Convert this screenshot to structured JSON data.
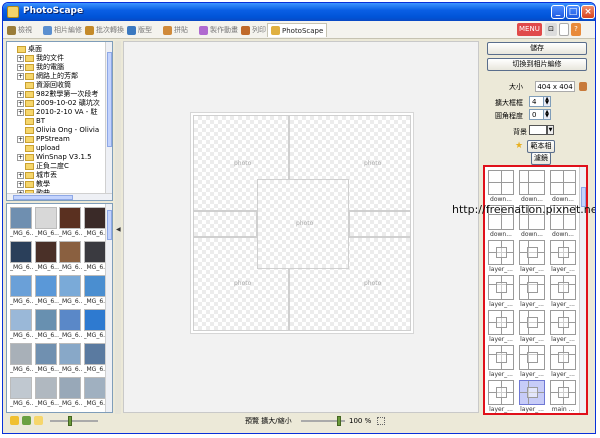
{
  "window": {
    "title": "PhotoScape"
  },
  "tabs": [
    {
      "label": "檢視",
      "icon": "viewer-icon",
      "color": "#9a7d3a"
    },
    {
      "label": "相片編修",
      "icon": "editor-icon",
      "color": "#5a8fd0"
    },
    {
      "label": "批次轉換",
      "icon": "batch-icon",
      "color": "#c48a2a"
    },
    {
      "label": "版型",
      "icon": "page-icon",
      "color": "#3a78c0"
    },
    {
      "label": "拼貼",
      "icon": "combine-icon",
      "color": "#d08a3a"
    },
    {
      "label": "製作動畫",
      "icon": "animated-gif-icon",
      "color": "#b06ad0"
    },
    {
      "label": "列印",
      "icon": "print-icon",
      "color": "#c06a2a"
    },
    {
      "label": "PhotoScape",
      "icon": "photoscape-icon",
      "color": "#e0b040"
    }
  ],
  "toolbar_tools": {
    "menu": "MENU",
    "window": "⊡",
    "help": "?"
  },
  "tree": {
    "items": [
      {
        "label": "桌面",
        "level": 0,
        "expander": ""
      },
      {
        "label": "我的文件",
        "level": 1,
        "expander": "+"
      },
      {
        "label": "我的電腦",
        "level": 1,
        "expander": "+"
      },
      {
        "label": "網路上的芳鄰",
        "level": 1,
        "expander": "+"
      },
      {
        "label": "資源回收筒",
        "level": 1,
        "expander": ""
      },
      {
        "label": "982數學第一次段考",
        "level": 1,
        "expander": "+"
      },
      {
        "label": "2009-10-02 礦坑次",
        "level": 1,
        "expander": "+"
      },
      {
        "label": "2010-2-10 VA - 駐",
        "level": 1,
        "expander": "+"
      },
      {
        "label": "BT",
        "level": 1,
        "expander": ""
      },
      {
        "label": "Olivia Ong - Olivia",
        "level": 1,
        "expander": ""
      },
      {
        "label": "PPStream",
        "level": 1,
        "expander": "+"
      },
      {
        "label": "upload",
        "level": 1,
        "expander": ""
      },
      {
        "label": "WinSnap V3.1.5",
        "level": 1,
        "expander": "+"
      },
      {
        "label": "正負二度C",
        "level": 1,
        "expander": ""
      },
      {
        "label": "城市丟",
        "level": 1,
        "expander": "+"
      },
      {
        "label": "教學",
        "level": 1,
        "expander": "+"
      },
      {
        "label": "歌曲",
        "level": 1,
        "expander": "+"
      }
    ]
  },
  "thumbnails": [
    {
      "caption": "_MG_6...",
      "color": "#6f8fb0"
    },
    {
      "caption": "_MG_6...",
      "color": "#d8d8d8"
    },
    {
      "caption": "_MG_6...",
      "color": "#5a3020"
    },
    {
      "caption": "_MG_6...",
      "color": "#3a2a28"
    },
    {
      "caption": "_MG_6...",
      "color": "#2a3f5a"
    },
    {
      "caption": "_MG_6...",
      "color": "#4a3028"
    },
    {
      "caption": "_MG_6...",
      "color": "#8a6040"
    },
    {
      "caption": "_MG_6...",
      "color": "#3a3a40"
    },
    {
      "caption": "_MG_6...",
      "color": "#6aa0d8"
    },
    {
      "caption": "_MG_6...",
      "color": "#5a98d8"
    },
    {
      "caption": "_MG_6...",
      "color": "#7aaad8"
    },
    {
      "caption": "_MG_6...",
      "color": "#4a8ed0"
    },
    {
      "caption": "_MG_6...",
      "color": "#9ab8d8"
    },
    {
      "caption": "_MG_6...",
      "color": "#6890b0"
    },
    {
      "caption": "_MG_6...",
      "color": "#5a88c8"
    },
    {
      "caption": "_MG_6...",
      "color": "#2e7ad0"
    },
    {
      "caption": "_MG_6...",
      "color": "#a8b0b8"
    },
    {
      "caption": "_MG_6...",
      "color": "#7090b0"
    },
    {
      "caption": "_MG_6...",
      "color": "#88a8c8"
    },
    {
      "caption": "_MG_6...",
      "color": "#5a7aa0"
    },
    {
      "caption": "_MG_6...",
      "color": "#c0c8d0"
    },
    {
      "caption": "_MG_6...",
      "color": "#b0b8c0"
    },
    {
      "caption": "_MG_6...",
      "color": "#98a8b8"
    },
    {
      "caption": "_MG_6...",
      "color": "#a0b0c0"
    }
  ],
  "canvas": {
    "cell_label": "photo"
  },
  "status": {
    "label": "預覽 擴大/縮小",
    "zoom": "100 %"
  },
  "right": {
    "save_label": "儲存",
    "switch_label": "切換到相片編修",
    "size_label": "大小",
    "size_value": "404 x 404",
    "margin_label": "擴大框框",
    "margin_value": "4",
    "round_label": "圓角程度",
    "round_value": "0",
    "bg_label": "背景",
    "frame_label": "範本相框",
    "filter_label": "濾鏡"
  },
  "templates": [
    {
      "caption": "down..."
    },
    {
      "caption": "down..."
    },
    {
      "caption": "down..."
    },
    {
      "caption": "down..."
    },
    {
      "caption": "down..."
    },
    {
      "caption": "down..."
    },
    {
      "caption": "layer_..."
    },
    {
      "caption": "layer_..."
    },
    {
      "caption": "layer_..."
    },
    {
      "caption": "layer_..."
    },
    {
      "caption": "layer_..."
    },
    {
      "caption": "layer_..."
    },
    {
      "caption": "layer_..."
    },
    {
      "caption": "layer_..."
    },
    {
      "caption": "layer_..."
    },
    {
      "caption": "layer_..."
    },
    {
      "caption": "layer_..."
    },
    {
      "caption": "layer_..."
    },
    {
      "caption": "layer_..."
    },
    {
      "caption": "layer_...",
      "selected": true
    },
    {
      "caption": "main ..."
    }
  ],
  "watermark": "http://freenation.pixnet.net/blog",
  "colors": {
    "highlight_border": "#e0101a",
    "title_bar": "#0a5fe4"
  }
}
